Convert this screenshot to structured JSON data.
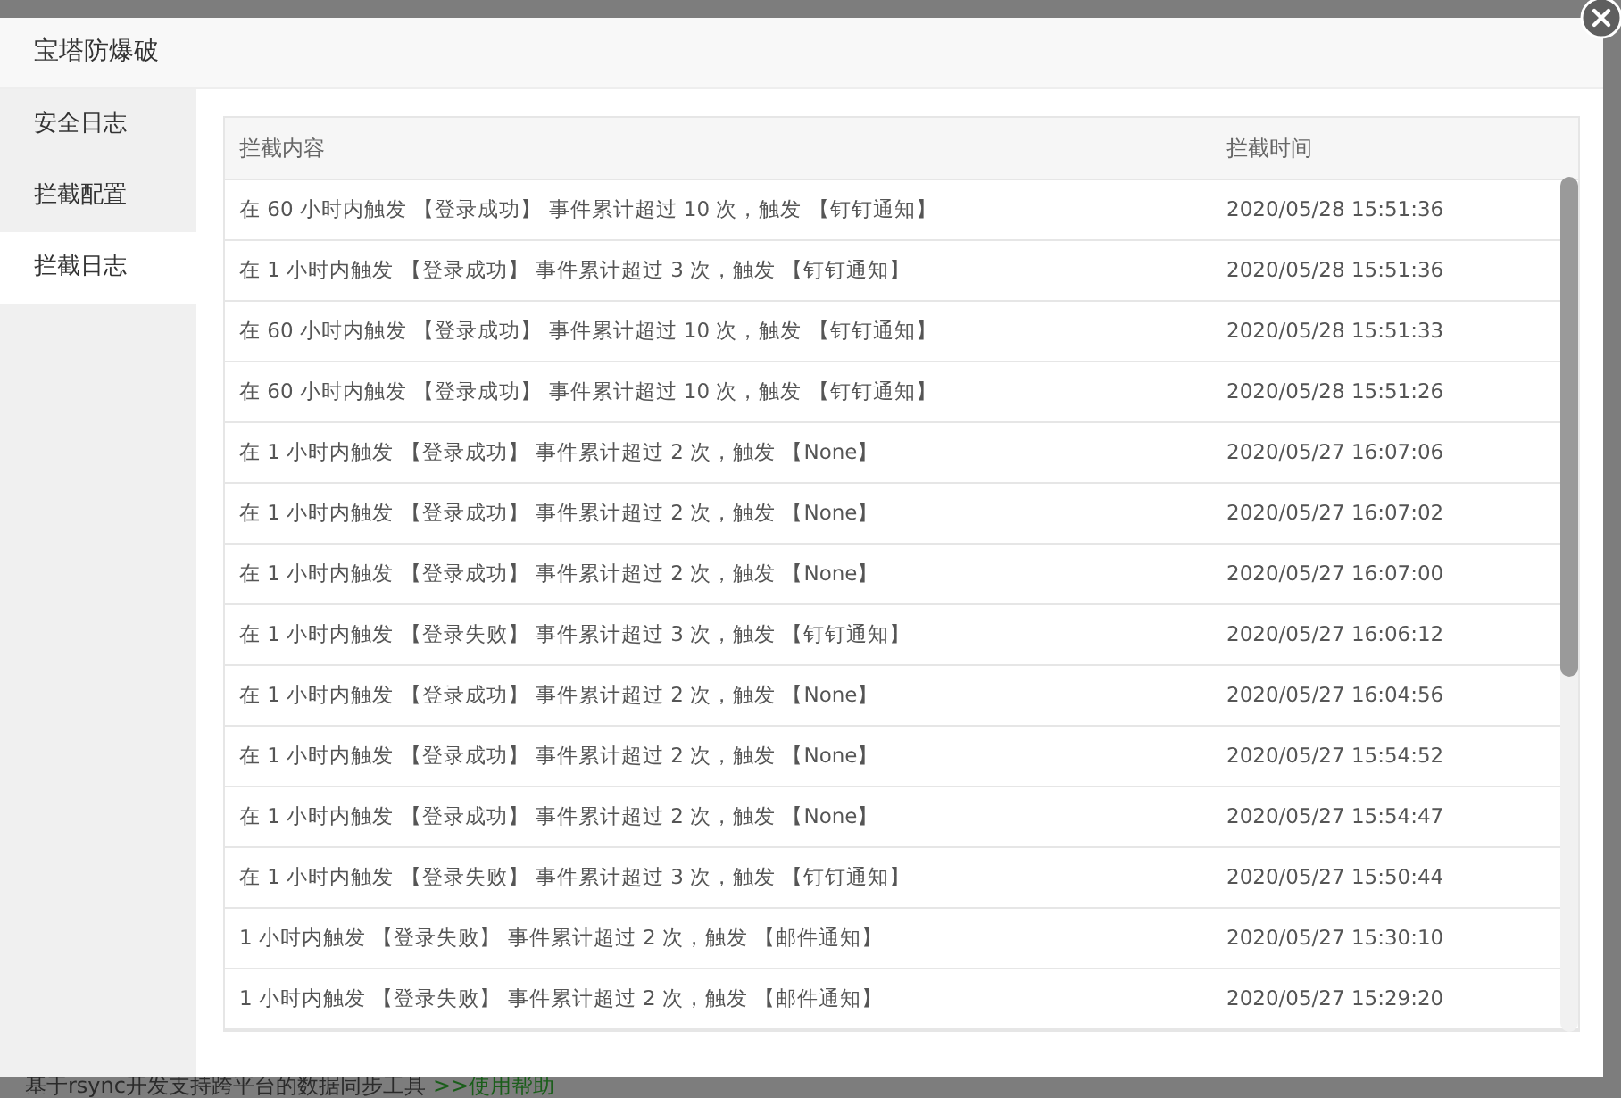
{
  "dialog": {
    "title": "宝塔防爆破"
  },
  "sidebar": {
    "items": [
      {
        "label": "安全日志",
        "selected": false
      },
      {
        "label": "拦截配置",
        "selected": false
      },
      {
        "label": "拦截日志",
        "selected": true
      }
    ]
  },
  "table": {
    "columns": [
      "拦截内容",
      "拦截时间"
    ],
    "rows": [
      {
        "content": "在 60 小时内触发 【登录成功】 事件累计超过 10 次，触发 【钉钉通知】",
        "time": "2020/05/28 15:51:36"
      },
      {
        "content": "在 1 小时内触发 【登录成功】 事件累计超过 3 次，触发 【钉钉通知】",
        "time": "2020/05/28 15:51:36"
      },
      {
        "content": "在 60 小时内触发 【登录成功】 事件累计超过 10 次，触发 【钉钉通知】",
        "time": "2020/05/28 15:51:33"
      },
      {
        "content": "在 60 小时内触发 【登录成功】 事件累计超过 10 次，触发 【钉钉通知】",
        "time": "2020/05/28 15:51:26"
      },
      {
        "content": "在 1 小时内触发 【登录成功】 事件累计超过 2 次，触发 【None】",
        "time": "2020/05/27 16:07:06"
      },
      {
        "content": "在 1 小时内触发 【登录成功】 事件累计超过 2 次，触发 【None】",
        "time": "2020/05/27 16:07:02"
      },
      {
        "content": "在 1 小时内触发 【登录成功】 事件累计超过 2 次，触发 【None】",
        "time": "2020/05/27 16:07:00"
      },
      {
        "content": "在 1 小时内触发 【登录失败】 事件累计超过 3 次，触发 【钉钉通知】",
        "time": "2020/05/27 16:06:12"
      },
      {
        "content": "在 1 小时内触发 【登录成功】 事件累计超过 2 次，触发 【None】",
        "time": "2020/05/27 16:04:56"
      },
      {
        "content": "在 1 小时内触发 【登录成功】 事件累计超过 2 次，触发 【None】",
        "time": "2020/05/27 15:54:52"
      },
      {
        "content": "在 1 小时内触发 【登录成功】 事件累计超过 2 次，触发 【None】",
        "time": "2020/05/27 15:54:47"
      },
      {
        "content": "在 1 小时内触发 【登录失败】 事件累计超过 3 次，触发 【钉钉通知】",
        "time": "2020/05/27 15:50:44"
      },
      {
        "content": "1 小时内触发 【登录失败】 事件累计超过 2 次，触发 【邮件通知】",
        "time": "2020/05/27 15:30:10"
      },
      {
        "content": "1 小时内触发 【登录失败】 事件累计超过 2 次，触发 【邮件通知】",
        "time": "2020/05/27 15:29:20"
      }
    ]
  },
  "background_page": {
    "text": "基于rsync开发支持跨平台的数据同步工具",
    "link": ">>使用帮助"
  }
}
